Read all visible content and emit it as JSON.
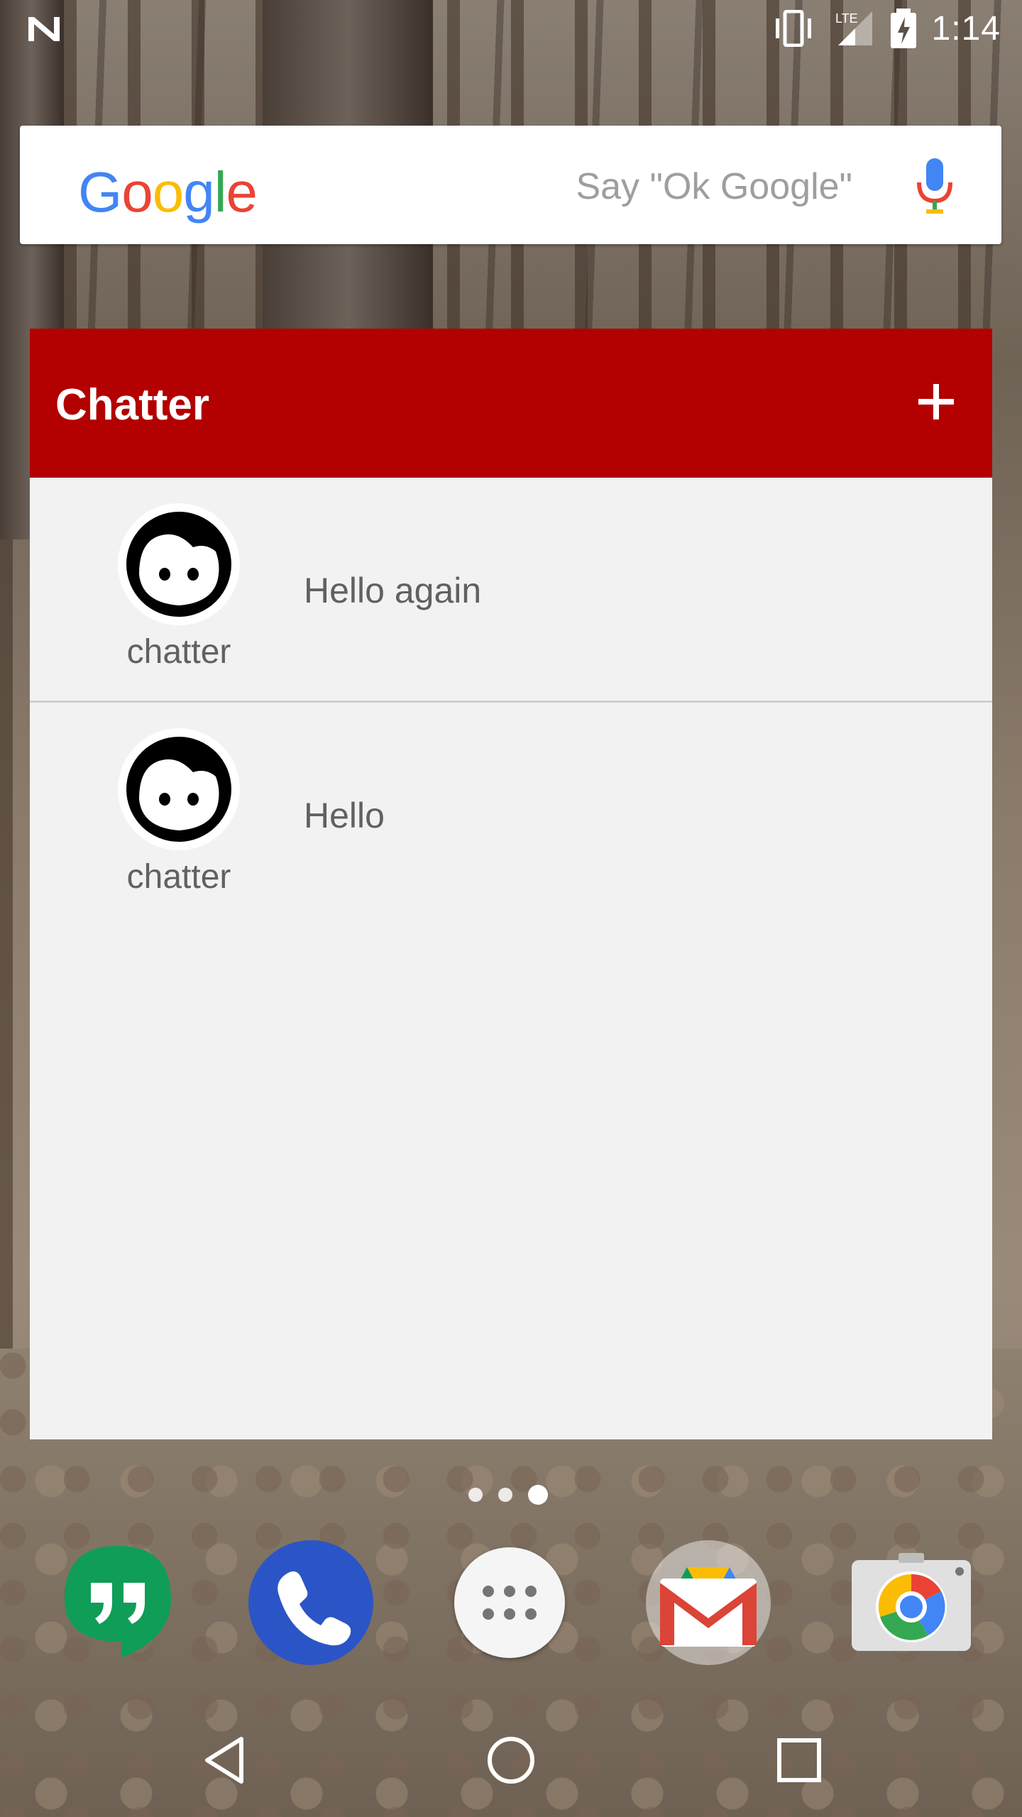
{
  "status_bar": {
    "time": "1:14",
    "network": "LTE",
    "icons": [
      "n-notification-icon",
      "vibrate-icon",
      "lte-signal-icon",
      "battery-charging-icon"
    ]
  },
  "search": {
    "logo_text": "Google",
    "hint": "Say \"Ok Google\"",
    "icon": "mic-icon"
  },
  "widget": {
    "title": "Chatter",
    "add_icon": "plus-icon",
    "header_color": "#b30000",
    "messages": [
      {
        "sender": "chatter",
        "text": "Hello again",
        "avatar": "face-avatar-icon"
      },
      {
        "sender": "chatter",
        "text": "Hello",
        "avatar": "face-avatar-icon"
      }
    ]
  },
  "page_indicator": {
    "count": 3,
    "active_index": 2
  },
  "dock": {
    "apps": [
      "hangouts-icon",
      "phone-icon",
      "app-drawer-icon",
      "gmail-icon",
      "camera-icon"
    ]
  },
  "nav_bar": {
    "buttons": [
      "back-icon",
      "home-icon",
      "recents-icon"
    ]
  }
}
